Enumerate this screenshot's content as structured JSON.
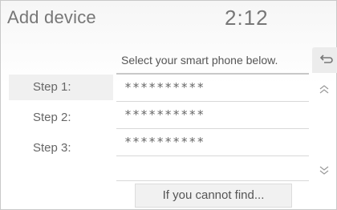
{
  "header": {
    "title": "Add device",
    "clock": "2:12"
  },
  "steps": [
    {
      "label": "Step 1:"
    },
    {
      "label": "Step 2:"
    },
    {
      "label": "Step 3:"
    }
  ],
  "panel": {
    "instruction": "Select your smart phone below.",
    "devices": [
      {
        "name": "**********"
      },
      {
        "name": "**********"
      },
      {
        "name": "**********"
      }
    ]
  },
  "buttons": {
    "cant_find_label": "If you cannot find..."
  },
  "icons": {
    "back": "back-arrow-icon",
    "scroll_up": "chevron-up-icon",
    "scroll_down": "chevron-down-icon"
  }
}
